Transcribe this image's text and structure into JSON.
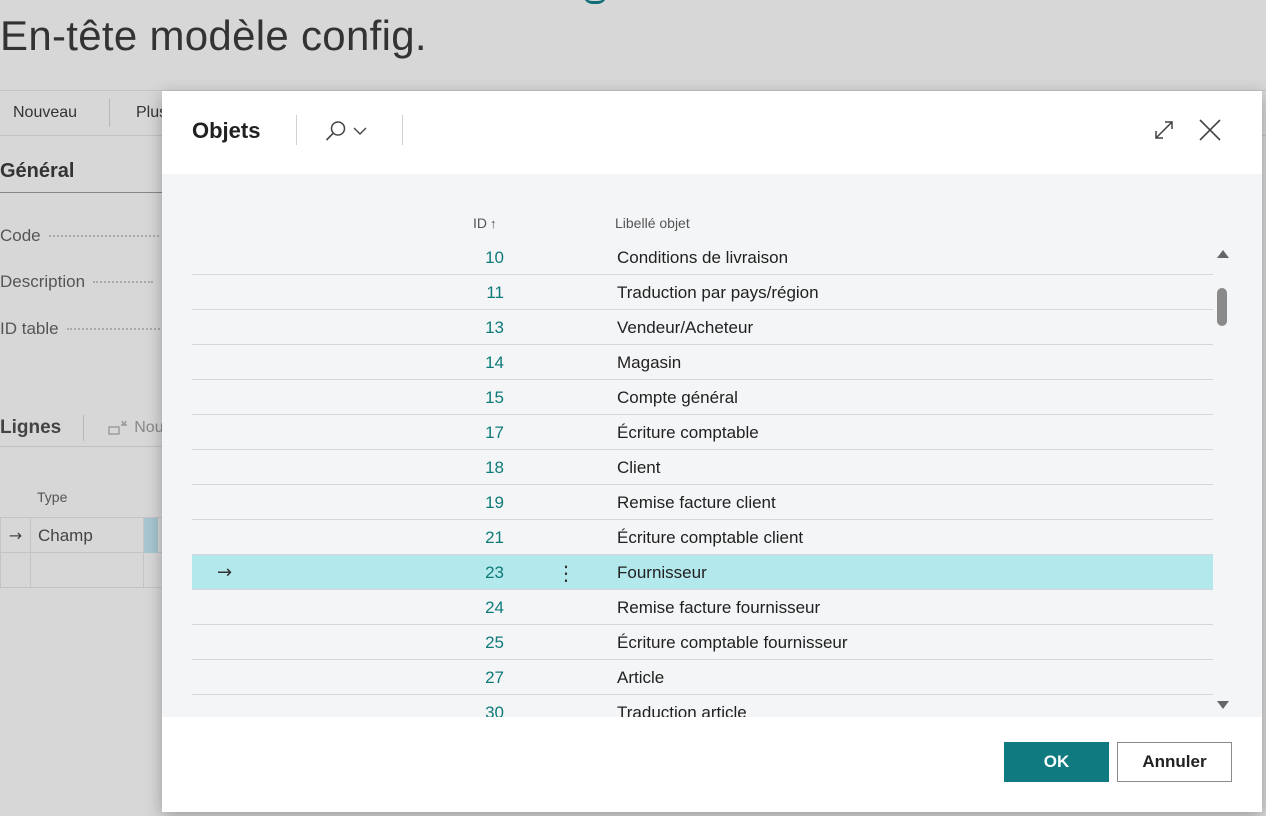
{
  "background": {
    "page_title": "En-tête modèle config.",
    "actions": {
      "new_label": "Nouveau",
      "more_label": "Plus"
    },
    "general_section": "Général",
    "fields": [
      {
        "label": "Code"
      },
      {
        "label": "Description"
      },
      {
        "label": "ID table"
      }
    ],
    "lines_section": "Lignes",
    "lines_new_label": "Nou",
    "lines_column_type": "Type",
    "lines_rows": [
      {
        "type": "Champ"
      },
      {
        "type": ""
      }
    ]
  },
  "dialog": {
    "title": "Objets",
    "columns": {
      "id": "ID",
      "sort_indicator": "↑",
      "label": "Libellé objet"
    },
    "rows": [
      {
        "id": "10",
        "name": "Conditions de livraison"
      },
      {
        "id": "11",
        "name": "Traduction par pays/région"
      },
      {
        "id": "13",
        "name": "Vendeur/Acheteur"
      },
      {
        "id": "14",
        "name": "Magasin"
      },
      {
        "id": "15",
        "name": "Compte général"
      },
      {
        "id": "17",
        "name": "Écriture comptable"
      },
      {
        "id": "18",
        "name": "Client"
      },
      {
        "id": "19",
        "name": "Remise facture client"
      },
      {
        "id": "21",
        "name": "Écriture comptable client"
      },
      {
        "id": "23",
        "name": "Fournisseur",
        "selected": true
      },
      {
        "id": "24",
        "name": "Remise facture fournisseur"
      },
      {
        "id": "25",
        "name": "Écriture comptable fournisseur"
      },
      {
        "id": "27",
        "name": "Article"
      },
      {
        "id": "30",
        "name": "Traduction article"
      }
    ],
    "ok_label": "OK",
    "cancel_label": "Annuler",
    "icons": [
      "search-icon",
      "chevron-down-icon",
      "expand-icon",
      "close-icon",
      "row-arrow-icon",
      "more-menu-icon"
    ]
  },
  "colors": {
    "accent": "#0f7b80",
    "id_text": "#0f7a7a",
    "selected_row": "#b3e8ec"
  }
}
